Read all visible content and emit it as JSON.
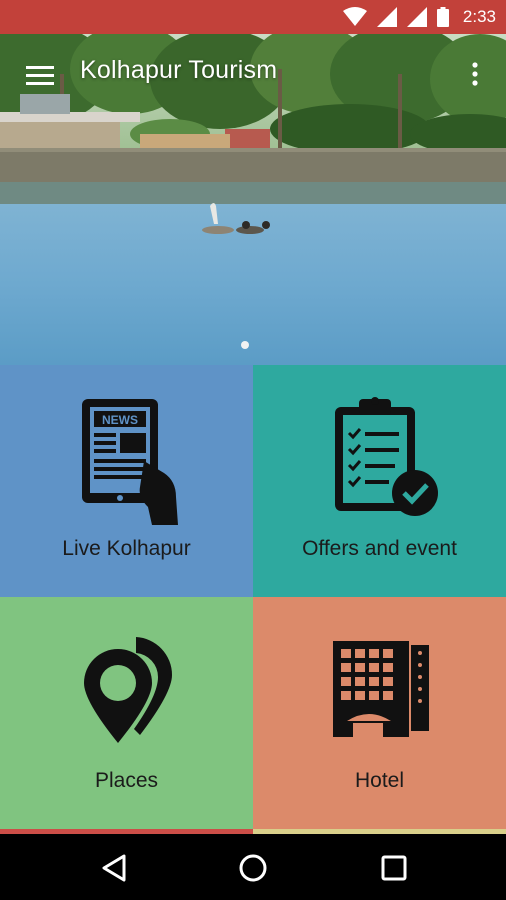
{
  "status_bar": {
    "time": "2:33",
    "icons": [
      "wifi-icon",
      "signal-icon",
      "signal-icon",
      "battery-icon"
    ],
    "background": "#c2413a"
  },
  "app_bar": {
    "title": "Kolhapur Tourism",
    "menu_icon": "hamburger-menu-icon",
    "overflow_icon": "more-vert-icon"
  },
  "hero": {
    "pager_dot_count": 1
  },
  "tiles": [
    {
      "label": "Live Kolhapur",
      "icon": "news-tablet-icon",
      "color": "#5f93c7"
    },
    {
      "label": "Offers and event",
      "icon": "clipboard-check-icon",
      "color": "#2ea99f"
    },
    {
      "label": "Places",
      "icon": "map-pins-icon",
      "color": "#80c480"
    },
    {
      "label": "Hotel",
      "icon": "hotel-building-icon",
      "color": "#dc8a6a"
    }
  ],
  "nav_bar": {
    "buttons": [
      "back-icon",
      "home-icon",
      "recents-icon"
    ]
  }
}
